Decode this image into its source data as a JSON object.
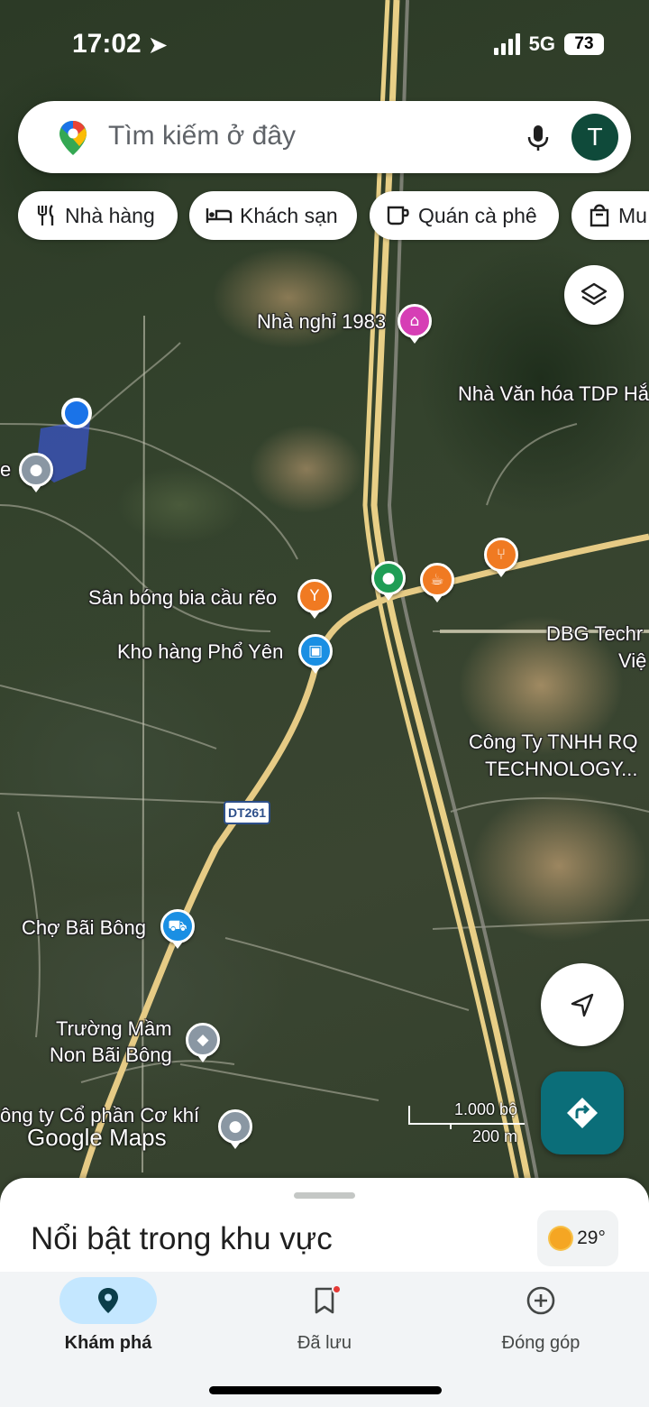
{
  "status_bar": {
    "time": "17:02",
    "network": "5G",
    "battery": "73"
  },
  "search": {
    "placeholder": "Tìm kiếm ở đây",
    "avatar_letter": "T"
  },
  "chips": [
    {
      "label": "Nhà hàng",
      "icon": "restaurant-icon"
    },
    {
      "label": "Khách sạn",
      "icon": "bed-icon"
    },
    {
      "label": "Quán cà phê",
      "icon": "coffee-icon"
    },
    {
      "label": "Mu",
      "icon": "shopping-bag-icon"
    }
  ],
  "map": {
    "labels": {
      "nha_nghi": "Nhà nghỉ 1983",
      "nha_van_hoa": "Nhà Văn hóa TDP Hắ",
      "san_bong": "Sân bóng bia cầu rẽo",
      "kho_hang": "Kho hàng Phổ Yên",
      "dbg_1": "DBG Techr",
      "dbg_2": "Việ",
      "cong_ty_rq_1": "Công Ty TNHH RQ",
      "cong_ty_rq_2": "TECHNOLOGY...",
      "cho": "Chợ Bãi Bông",
      "truong_1": "Trường Mầm",
      "truong_2": "Non Bãi Bông",
      "cong_ty_co_khi": "ông ty Cổ phần Cơ khí",
      "left_edge": "e"
    },
    "route_shield": "DT261",
    "scale": {
      "imperial": "1.000 bộ",
      "metric": "200 m"
    },
    "watermark": "Google Maps"
  },
  "sheet": {
    "title": "Nổi bật trong khu vực",
    "temperature": "29°"
  },
  "nav": [
    {
      "label": "Khám phá",
      "icon": "explore-pin-icon",
      "active": true
    },
    {
      "label": "Đã lưu",
      "icon": "bookmark-icon",
      "active": false
    },
    {
      "label": "Đóng góp",
      "icon": "add-circle-icon",
      "active": false
    }
  ]
}
